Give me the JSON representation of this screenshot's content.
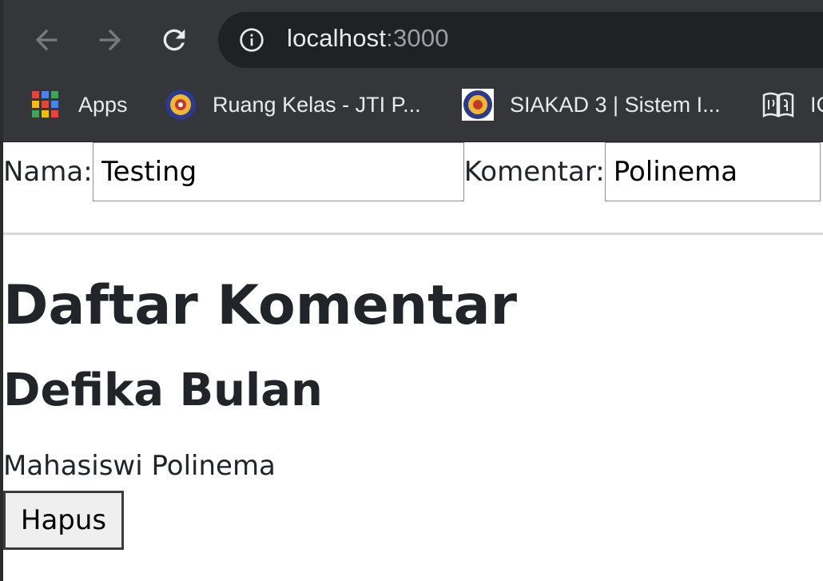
{
  "browser": {
    "url_host": "localhost",
    "url_port": ":3000",
    "bookmarks": [
      {
        "label": "Apps",
        "icon": "apps-grid-icon"
      },
      {
        "label": "Ruang Kelas - JTI P...",
        "icon": "polinema-logo-icon"
      },
      {
        "label": "SIAKAD 3 | Sistem I...",
        "icon": "polinema-logo-icon"
      },
      {
        "label": "IC",
        "icon": "book-icon"
      }
    ]
  },
  "form": {
    "nama_label": "Nama:",
    "nama_value": "Testing",
    "komentar_label": "Komentar:",
    "komentar_value": "Polinema"
  },
  "page": {
    "title": "Daftar Komentar",
    "comments": [
      {
        "name": "Defika Bulan",
        "text": "Mahasiswi Polinema",
        "delete_label": "Hapus"
      }
    ]
  },
  "colors": {
    "chrome_bg": "#35363a",
    "omnibox_bg": "#202124",
    "text_dark": "#212529"
  }
}
